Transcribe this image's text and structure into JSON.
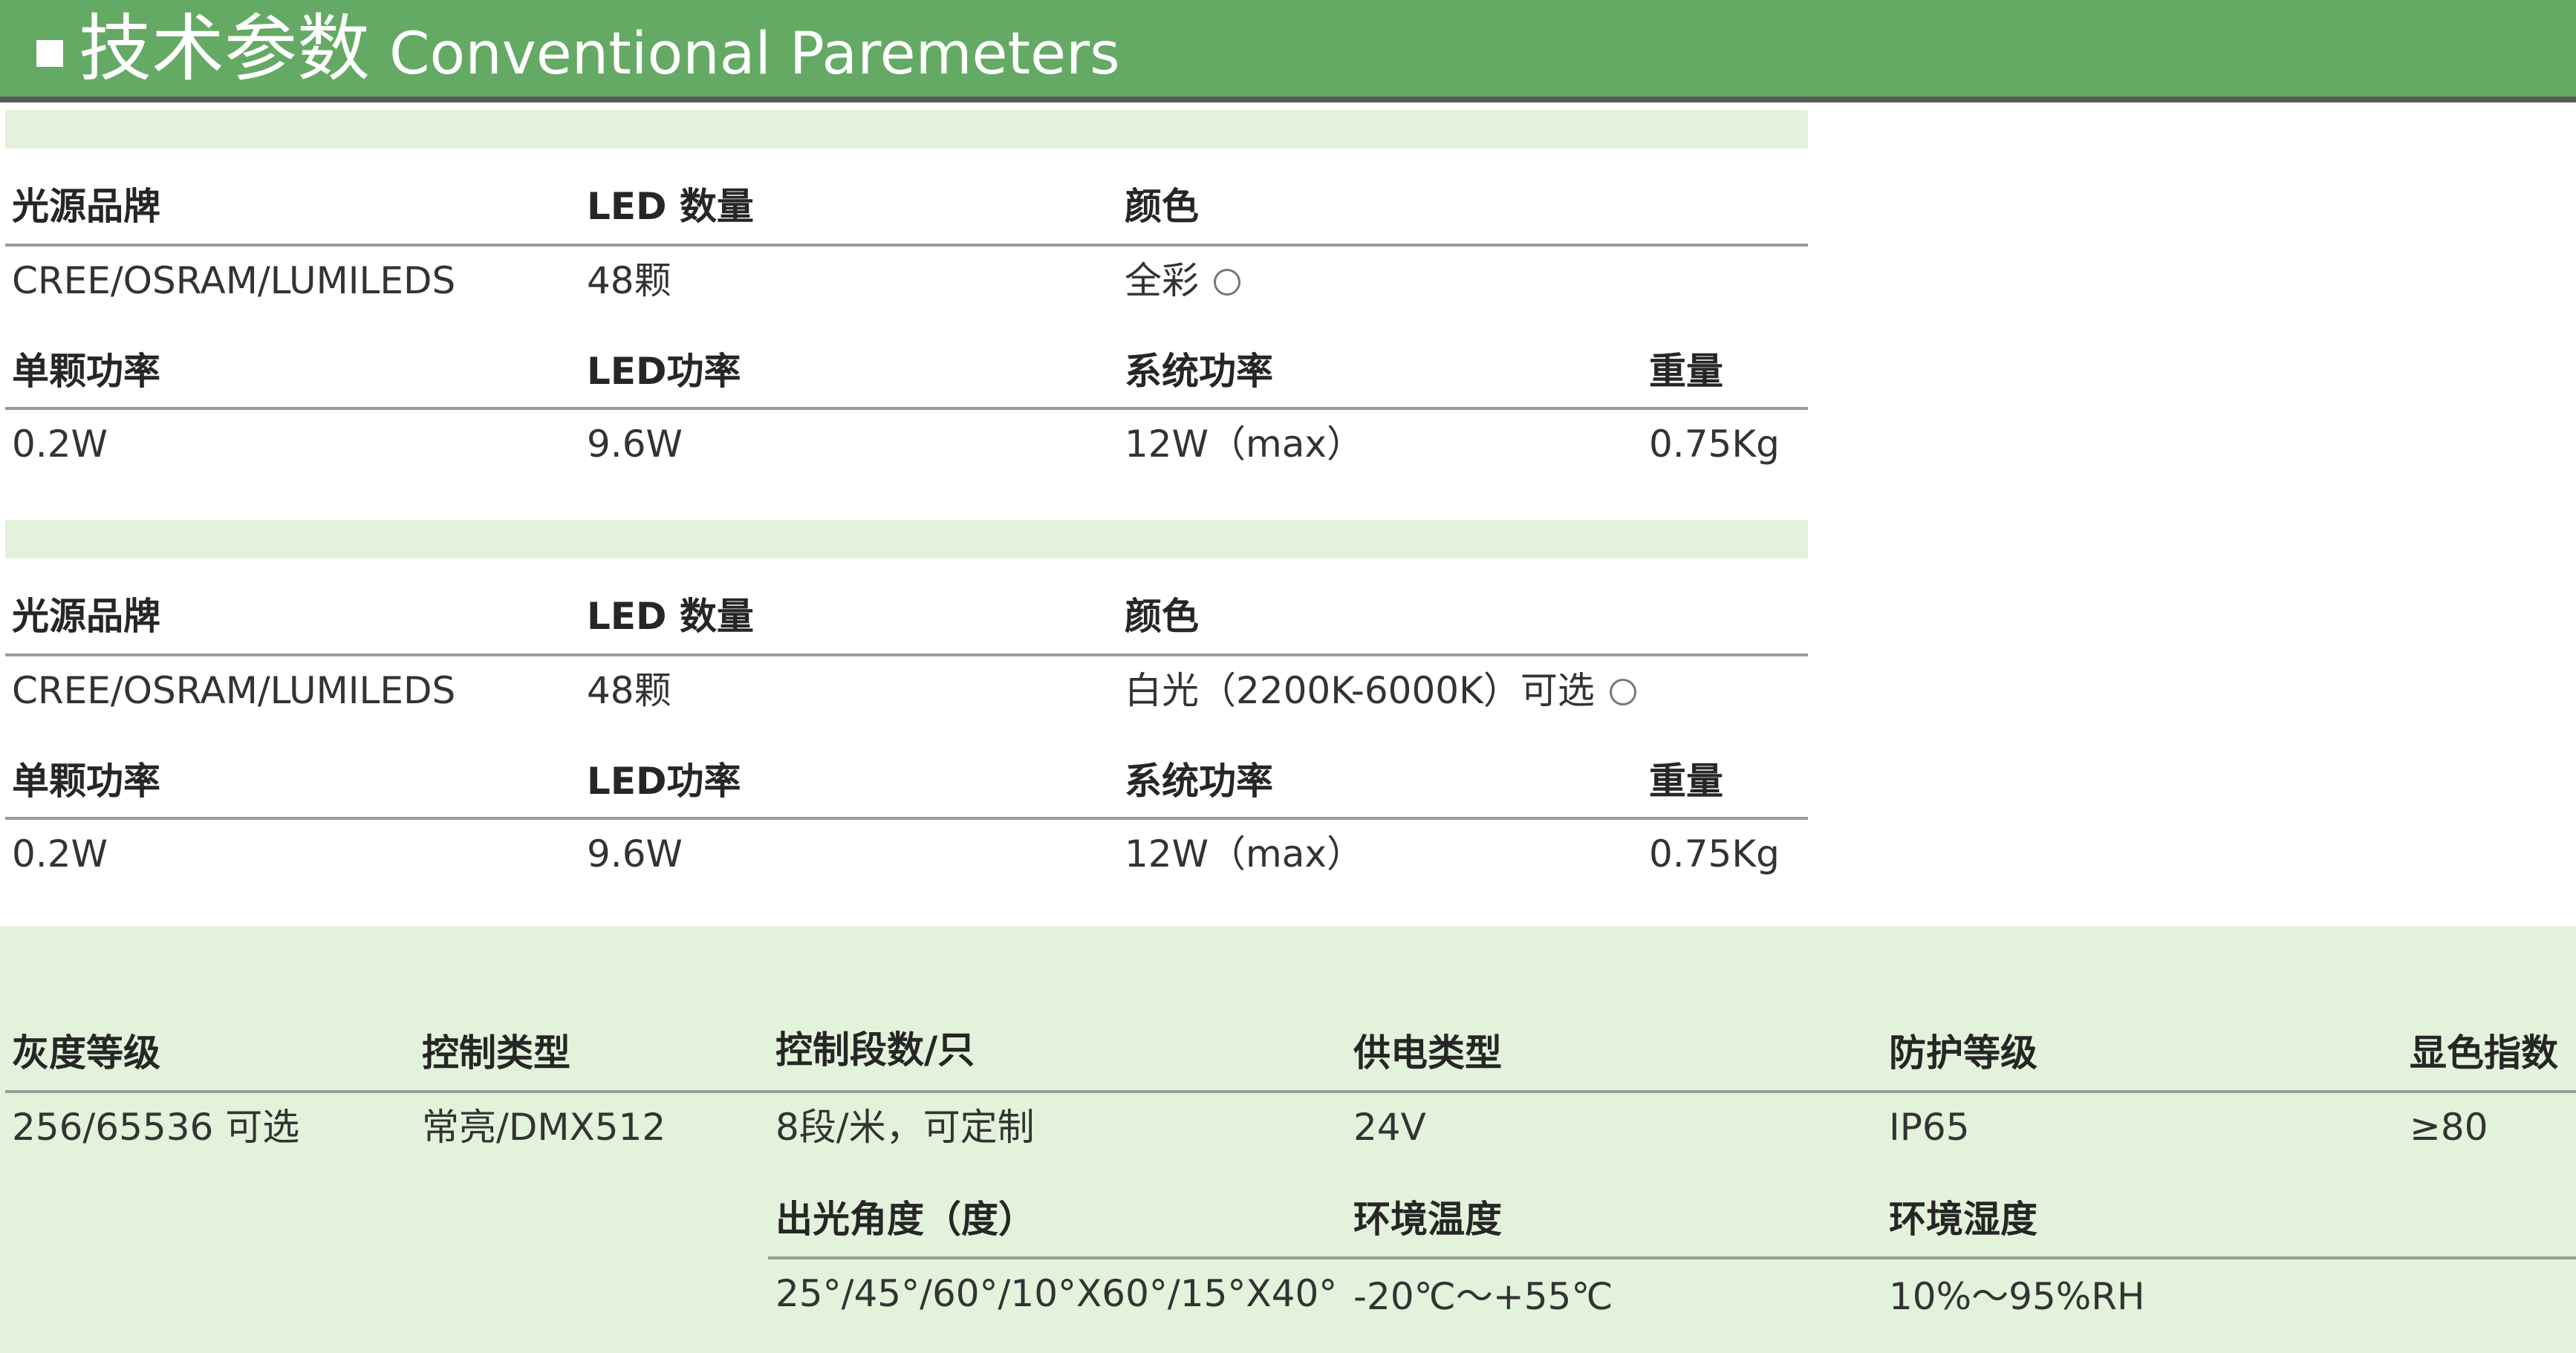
{
  "header": {
    "title_zh": "技术参数",
    "title_en": "Conventional Paremeters"
  },
  "block1": {
    "labels": [
      "光源品牌",
      "LED 数量",
      "颜色"
    ],
    "values": [
      "CREE/OSRAM/LUMILEDS",
      "48颗",
      "全彩"
    ],
    "labels2": [
      "单颗功率",
      "LED功率",
      "系统功率",
      "重量"
    ],
    "values2": [
      "0.2W",
      "9.6W",
      "12W（max）",
      "0.75Kg"
    ]
  },
  "block2": {
    "labels": [
      "光源品牌",
      "LED 数量",
      "颜色"
    ],
    "values": [
      "CREE/OSRAM/LUMILEDS",
      "48颗",
      "白光（2200K-6000K）可选"
    ],
    "labels2": [
      "单颗功率",
      "LED功率",
      "系统功率",
      "重量"
    ],
    "values2": [
      "0.2W",
      "9.6W",
      "12W（max）",
      "0.75Kg"
    ]
  },
  "common": {
    "labels": [
      "灰度等级",
      "控制类型",
      "控制段数/只",
      "供电类型",
      "防护等级",
      "显色指数"
    ],
    "values": [
      "256/65536 可选",
      "常亮/DMX512",
      "8段/米，可定制",
      "24V",
      "IP65",
      "≥80"
    ],
    "labels2": [
      "出光角度（度）",
      "环境温度",
      "环境湿度"
    ],
    "values2": [
      "25°/45°/60°/10°X60°/15°X40°",
      "-20℃～+55℃",
      "10%～95%RH"
    ]
  }
}
